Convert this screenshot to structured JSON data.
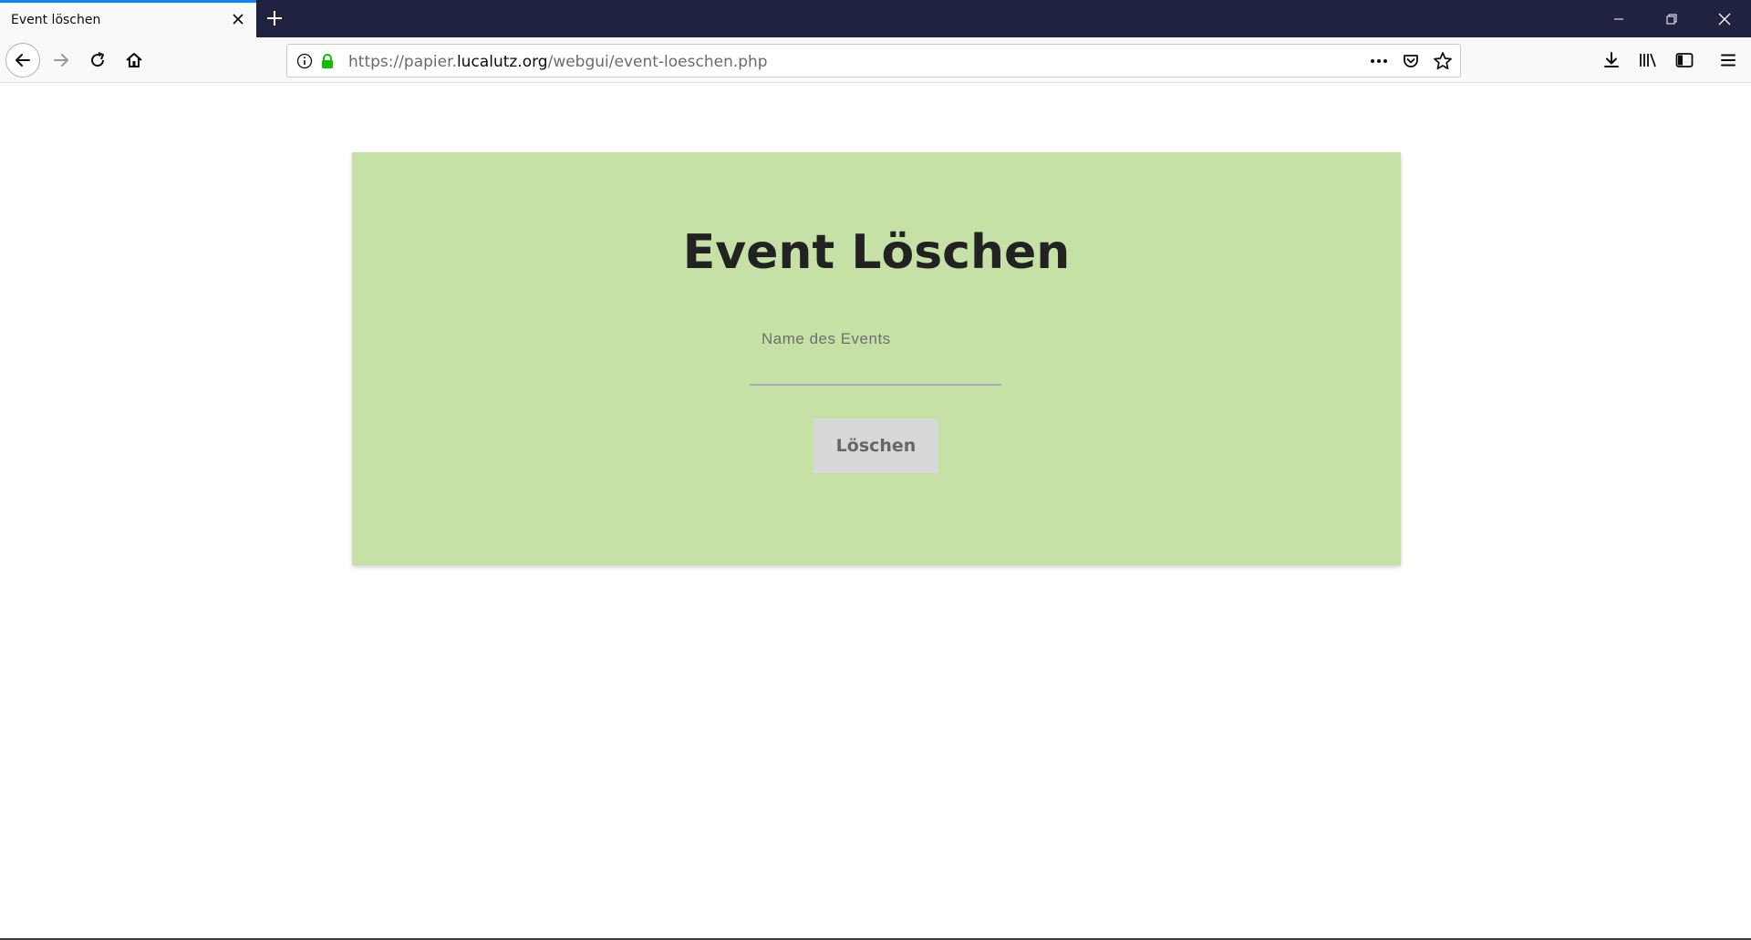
{
  "browser": {
    "tab_title": "Event löschen",
    "url_prefix": "https://papier.",
    "url_domain": "lucalutz.org",
    "url_path": "/webgui/event-loeschen.php",
    "accent_color": "#0a84ff",
    "tabstrip_color": "#202340",
    "icons": {
      "tab_close": "close-icon",
      "new_tab": "plus-icon",
      "minimize": "minimize-icon",
      "restore": "restore-icon",
      "window_close": "close-icon",
      "back": "arrow-left-icon",
      "forward": "arrow-right-icon",
      "reload": "reload-icon",
      "home": "home-icon",
      "site_info": "info-icon",
      "secure": "lock-icon",
      "page_actions": "ellipsis-icon",
      "pocket": "pocket-icon",
      "bookmark": "star-icon",
      "downloads": "download-icon",
      "library": "library-icon",
      "sidebar": "sidebar-icon",
      "menu": "hamburger-icon"
    }
  },
  "page": {
    "title": "Event Löschen",
    "field_label": "Name des Events",
    "field_value": "",
    "submit_label": "Löschen",
    "card_color": "#c5e1a5",
    "button_color": "#d8d8d8"
  }
}
